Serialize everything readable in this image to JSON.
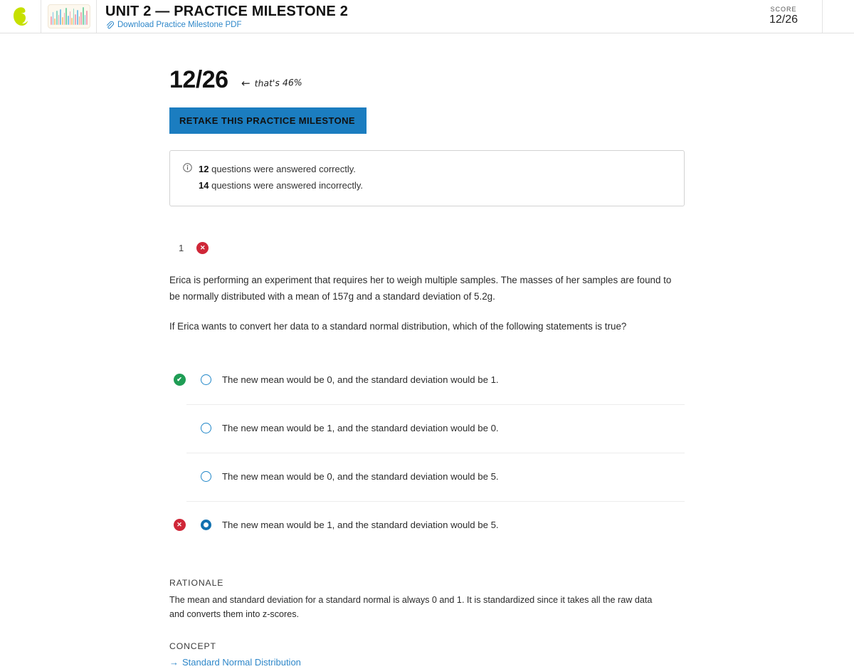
{
  "header": {
    "logo_name": "sophia-logo",
    "thumbnail_name": "bar-chart-thumbnail",
    "title": "UNIT 2 — PRACTICE MILESTONE 2",
    "pdf_link": "Download Practice Milestone PDF",
    "pdf_icon": "paperclip-icon",
    "score_label": "SCORE",
    "score_value": "12/26"
  },
  "results": {
    "big_score": "12/26",
    "annotation_arrow": "←",
    "annotation_text": "that's 46%",
    "retake_label": "RETAKE THIS PRACTICE MILESTONE",
    "info_icon": "info-icon",
    "correct_count": "12",
    "correct_text": "questions were answered correctly.",
    "incorrect_count": "14",
    "incorrect_text": "questions were answered incorrectly."
  },
  "question": {
    "number": "1",
    "status": "incorrect",
    "status_icon": "x-circle-icon",
    "paragraph_1": "Erica is performing an experiment that requires her to weigh multiple samples. The masses of her samples are found to be normally distributed with a mean of 157g and a standard deviation of 5.2g.",
    "paragraph_2": "If Erica wants to convert her data to a standard normal distribution, which of the following statements is true?",
    "options": [
      {
        "text": "The new mean would be 0, and the standard deviation would be 1.",
        "marker": "correct",
        "marker_icon": "check-circle-icon",
        "selected": false
      },
      {
        "text": "The new mean would be 1, and the standard deviation would be 0.",
        "marker": "none",
        "marker_icon": "",
        "selected": false
      },
      {
        "text": "The new mean would be 0, and the standard deviation would be 5.",
        "marker": "none",
        "marker_icon": "",
        "selected": false
      },
      {
        "text": "The new mean would be 1, and the standard deviation would be 5.",
        "marker": "incorrect",
        "marker_icon": "x-circle-icon",
        "selected": true
      }
    ],
    "rationale_label": "RATIONALE",
    "rationale_text": "The mean and standard deviation for a standard normal is always 0 and 1.  It is standardized since it takes all the raw data and converts them into z-scores.",
    "concept_label": "CONCEPT",
    "concept_arrow": "→",
    "concept_link": "Standard Normal Distribution"
  },
  "colors": {
    "accent_blue": "#1b7dc0",
    "link_blue": "#2e87c9",
    "correct_green": "#1f9d55",
    "incorrect_red": "#cf2738",
    "logo_green": "#c6e000"
  }
}
